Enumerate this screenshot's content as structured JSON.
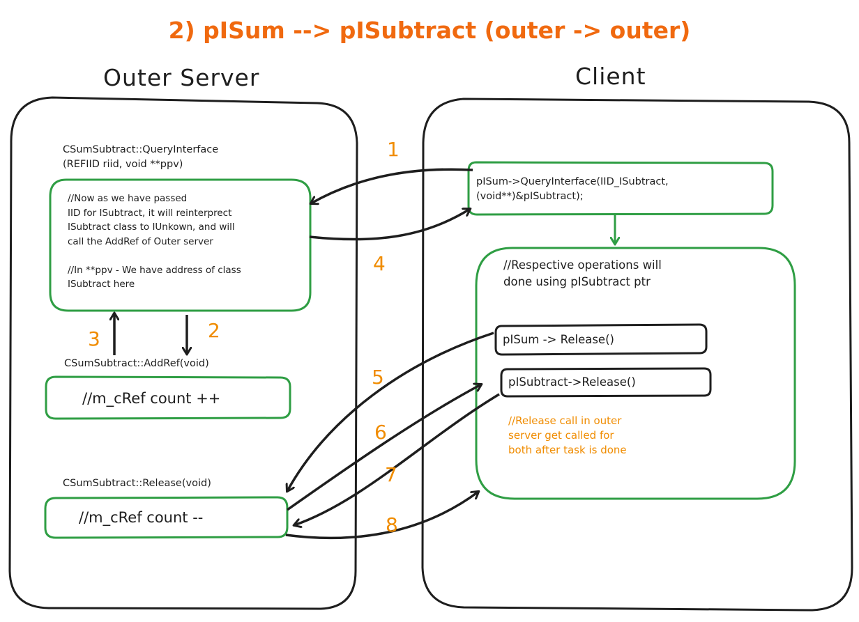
{
  "title": "2) pISum --> pISubtract (outer -> outer)",
  "outer_server": {
    "heading": "Outer Server",
    "qi_signature": "CSumSubtract::QueryInterface\n(REFIID riid, void **ppv)",
    "qi_body": "//Now as we have passed\nIID for ISubtract, it will reinterprect\nISubtract class to IUnkown, and will\ncall the AddRef of Outer server\n\n//In **ppv - We have address of class\nISubtract here",
    "addref_signature": "CSumSubtract::AddRef(void)",
    "addref_body": "//m_cRef count ++",
    "release_signature": "CSumSubtract::Release(void)",
    "release_body": "//m_cRef count --"
  },
  "client": {
    "heading": "Client",
    "qi_call": "pISum->QueryInterface(IID_ISubtract,\n(void**)&pISubtract);",
    "operations_note": "//Respective operations will\ndone using pISubtract ptr",
    "release_sum": "pISum -> Release()",
    "release_subtract": "pISubtract->Release()",
    "release_note": "//Release call in outer\nserver get called for\nboth after task is done"
  },
  "steps": [
    "1",
    "2",
    "3",
    "4",
    "5",
    "6",
    "7",
    "8"
  ],
  "colors": {
    "title": "#f0690f",
    "step_numbers": "#f08c00",
    "box_green": "#2f9e44",
    "stroke": "#1e1e1e"
  }
}
